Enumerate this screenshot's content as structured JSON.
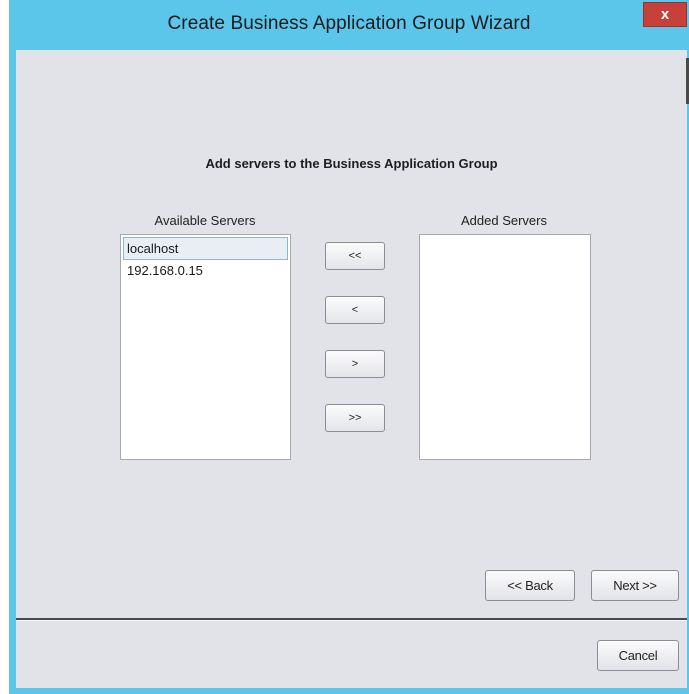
{
  "window": {
    "title": "Create Business Application Group Wizard",
    "close_label": "x"
  },
  "main": {
    "heading": "Add servers to the Business Application Group",
    "available": {
      "label": "Available Servers",
      "items": [
        "localhost",
        "192.168.0.15"
      ],
      "selected": "localhost"
    },
    "added": {
      "label": "Added Servers",
      "items": []
    },
    "move_buttons": {
      "remove_all": "<<",
      "remove": "<",
      "add": ">",
      "add_all": ">>"
    }
  },
  "nav": {
    "back": "<< Back",
    "next": "Next >>"
  },
  "footer": {
    "cancel": "Cancel"
  }
}
